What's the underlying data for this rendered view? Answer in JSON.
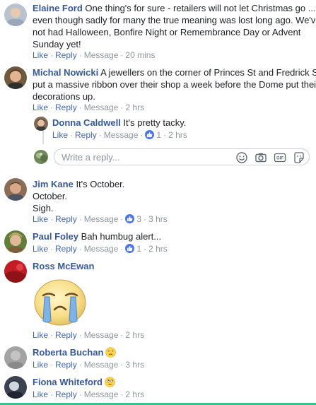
{
  "comments": [
    {
      "name": "Elaine Ford",
      "text_l1": "One thing's for sure - retailers will not let Christmas go ...",
      "text_l2": "even though sadly for many the true meaning was lost long ago. We've",
      "text_l3": "not had Halloween, Bonfire Night or Remembrance Day or Advent",
      "text_l4": "Sunday yet!",
      "like": "Like",
      "reply": "Reply",
      "message": "Message",
      "time": "20 mins"
    },
    {
      "name": "Michal Nowicki",
      "text_l1": "A jewellers on the corner of Princes St and Fredrick St",
      "text_l2": "put a massive ribbon over their shop a week before the Dome put their",
      "text_l3": "decorations up.",
      "like": "Like",
      "reply": "Reply",
      "message": "Message",
      "time": "2 hrs"
    },
    {
      "name": "Donna Caldwell",
      "text_l1": "It's pretty tacky.",
      "like": "Like",
      "reply": "Reply",
      "message": "Message",
      "likes": "1",
      "time": "2 hrs"
    },
    {
      "name": "Jim Kane",
      "text_l1": "It's October.",
      "text_l2": "October.",
      "text_l3": "Sigh.",
      "like": "Like",
      "reply": "Reply",
      "message": "Message",
      "likes": "3",
      "time": "3 hrs"
    },
    {
      "name": "Paul Foley",
      "text_l1": "Bah humbug alert...",
      "like": "Like",
      "reply": "Reply",
      "message": "Message",
      "likes": "1",
      "time": "2 hrs"
    },
    {
      "name": "Ross McEwan",
      "like": "Like",
      "reply": "Reply",
      "message": "Message",
      "time": "2 hrs"
    },
    {
      "name": "Roberta Buchan",
      "like": "Like",
      "reply": "Reply",
      "message": "Message",
      "time": "3 hrs"
    },
    {
      "name": "Fiona Whiteford",
      "like": "Like",
      "reply": "Reply",
      "message": "Message",
      "time": "2 hrs"
    }
  ],
  "reply_box": {
    "placeholder": "Write a reply..."
  },
  "icons": {
    "emoji": "smiley-icon",
    "camera": "camera-icon",
    "gif": "gif-icon",
    "sticker": "sticker-icon",
    "like_reaction": "thumbs-up-icon"
  },
  "colors": {
    "name": "#365899",
    "link": "#4267b2",
    "meta": "#90949c",
    "like_bubble": "#4a76e6"
  }
}
